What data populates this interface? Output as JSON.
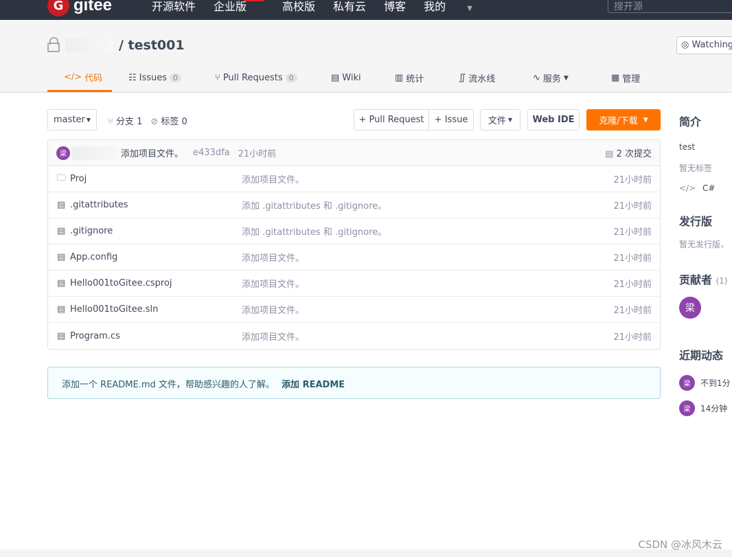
{
  "topbar": {
    "logo_text": "gitee",
    "nav": [
      "开源软件",
      "企业版",
      "高校版",
      "私有云",
      "博客",
      "我的"
    ],
    "search_placeholder": "搜开源"
  },
  "project": {
    "title": "/ test001",
    "watch": "Watching"
  },
  "tabs": [
    {
      "label": "代码",
      "icon": "code-icon"
    },
    {
      "label": "Issues",
      "count": "0"
    },
    {
      "label": "Pull Requests",
      "count": "0"
    },
    {
      "label": "Wiki"
    },
    {
      "label": "统计"
    },
    {
      "label": "流水线"
    },
    {
      "label": "服务"
    },
    {
      "label": "管理"
    }
  ],
  "toolbar": {
    "branch": "master",
    "branches": "分支 1",
    "tags": "标签 0",
    "pull_request": "+ Pull Request",
    "issue": "+ Issue",
    "file": "文件",
    "web_ide": "Web IDE",
    "clone": "克隆/下载"
  },
  "commit": {
    "avatar": "梁",
    "message": "添加项目文件。",
    "hash": "e433dfa",
    "time": "21小时前",
    "count": "2 次提交"
  },
  "files": [
    {
      "name": "Proj",
      "type": "folder",
      "message": "添加项目文件。",
      "time": "21小时前"
    },
    {
      "name": ".gitattributes",
      "type": "file",
      "message": "添加 .gitattributes 和 .gitignore。",
      "time": "21小时前"
    },
    {
      "name": ".gitignore",
      "type": "file",
      "message": "添加 .gitattributes 和 .gitignore。",
      "time": "21小时前"
    },
    {
      "name": "App.config",
      "type": "file",
      "message": "添加项目文件。",
      "time": "21小时前"
    },
    {
      "name": "Hello001toGitee.csproj",
      "type": "file",
      "message": "添加项目文件。",
      "time": "21小时前"
    },
    {
      "name": "Hello001toGitee.sln",
      "type": "file",
      "message": "添加项目文件。",
      "time": "21小时前"
    },
    {
      "name": "Program.cs",
      "type": "file",
      "message": "添加项目文件。",
      "time": "21小时前"
    }
  ],
  "readme": {
    "text": "添加一个 README.md 文件，帮助感兴趣的人了解。",
    "link": "添加 README"
  },
  "sidebar": {
    "intro_title": "简介",
    "intro": "test",
    "no_tags": "暂无标签",
    "lang": "C#",
    "release_title": "发行版",
    "no_release": "暂无发行版，",
    "contrib_title": "贡献者",
    "contrib_count": "(1)",
    "contrib_avatar": "梁",
    "activity_title": "近期动态",
    "activities": [
      {
        "avatar": "梁",
        "text": "不到1分"
      },
      {
        "avatar": "梁",
        "text": "14分钟"
      }
    ]
  },
  "watermark": "CSDN @冰风木云",
  "colors": {
    "accent": "#fe7300",
    "topbar": "#2e3340",
    "avatar": "#8e44ad"
  }
}
